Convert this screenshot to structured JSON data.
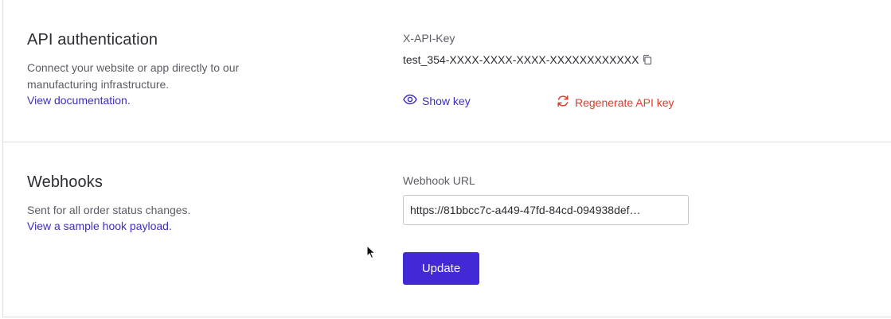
{
  "api_auth": {
    "title": "API authentication",
    "description": "Connect your website or app directly to our manufacturing infrastructure.",
    "doc_link": "View documentation.",
    "key_label": "X-API-Key",
    "key_value": "test_354-XXXX-XXXX-XXXX-XXXXXXXXXXXX",
    "show_key": "Show key",
    "regenerate": "Regenerate API key"
  },
  "webhooks": {
    "title": "Webhooks",
    "description": "Sent for all order status changes.",
    "sample_link": "View a sample hook payload.",
    "url_label": "Webhook URL",
    "url_value": "https://81bbcc7c-a449-47fd-84cd-094938def…",
    "update_button": "Update"
  },
  "colors": {
    "link": "#3c2fc0",
    "danger": "#d93c2b",
    "primary": "#4129d6"
  },
  "icons": {
    "copy": "copy-icon",
    "eye": "eye-icon",
    "refresh": "refresh-icon",
    "cursor": "mouse-cursor-icon"
  }
}
